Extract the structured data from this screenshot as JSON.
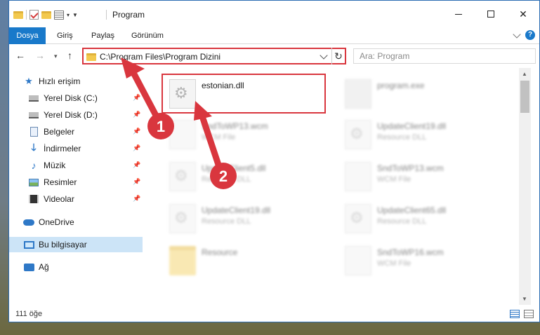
{
  "window": {
    "title": "Program"
  },
  "ribbon": {
    "tabs": [
      {
        "label": "Dosya",
        "active": true
      },
      {
        "label": "Giriş"
      },
      {
        "label": "Paylaş"
      },
      {
        "label": "Görünüm"
      }
    ]
  },
  "navigation": {
    "address": "C:\\Program Files\\Program Dizini",
    "search_placeholder": "Ara: Program"
  },
  "sidebar": {
    "items": [
      {
        "label": "Hızlı erişim",
        "icon": "star-icon"
      },
      {
        "label": "Yerel Disk (C:)",
        "icon": "disk-icon",
        "pinned": true
      },
      {
        "label": "Yerel Disk (D:)",
        "icon": "disk-icon",
        "pinned": true
      },
      {
        "label": "Belgeler",
        "icon": "documents-icon",
        "pinned": true
      },
      {
        "label": "İndirmeler",
        "icon": "download-icon",
        "pinned": true
      },
      {
        "label": "Müzik",
        "icon": "music-icon",
        "pinned": true
      },
      {
        "label": "Resimler",
        "icon": "pictures-icon",
        "pinned": true
      },
      {
        "label": "Videolar",
        "icon": "videos-icon",
        "pinned": true
      },
      {
        "label": "OneDrive",
        "icon": "onedrive-icon"
      },
      {
        "label": "Bu bilgisayar",
        "icon": "computer-icon",
        "selected": true
      },
      {
        "label": "Ağ",
        "icon": "network-icon"
      }
    ]
  },
  "files": [
    {
      "name": "estonian.dll",
      "type": "",
      "icon": "dll-icon",
      "highlighted": true
    },
    {
      "name": "program.exe",
      "type": "",
      "icon": "exe-icon"
    },
    {
      "name": "SndToWP13.wcm",
      "type": "WCM File",
      "icon": "document-icon"
    },
    {
      "name": "UpdateClient19.dll",
      "type": "Resource DLL",
      "icon": "dll-icon"
    },
    {
      "name": "UpdateClient5.dll",
      "type": "Resource DLL",
      "icon": "dll-icon"
    },
    {
      "name": "SndToWP13.wcm",
      "type": "WCM File",
      "icon": "document-icon"
    },
    {
      "name": "UpdateClient19.dll",
      "type": "Resource DLL",
      "icon": "dll-icon"
    },
    {
      "name": "UpdateClient65.dll",
      "type": "Resource DLL",
      "icon": "dll-icon"
    },
    {
      "name": "Resource",
      "type": "",
      "icon": "folder-icon"
    },
    {
      "name": "SndToWP16.wcm",
      "type": "WCM File",
      "icon": "document-icon"
    }
  ],
  "status": {
    "item_count": "111 öğe"
  },
  "annotations": {
    "step1": "1",
    "step2": "2",
    "color": "#d9363e"
  }
}
